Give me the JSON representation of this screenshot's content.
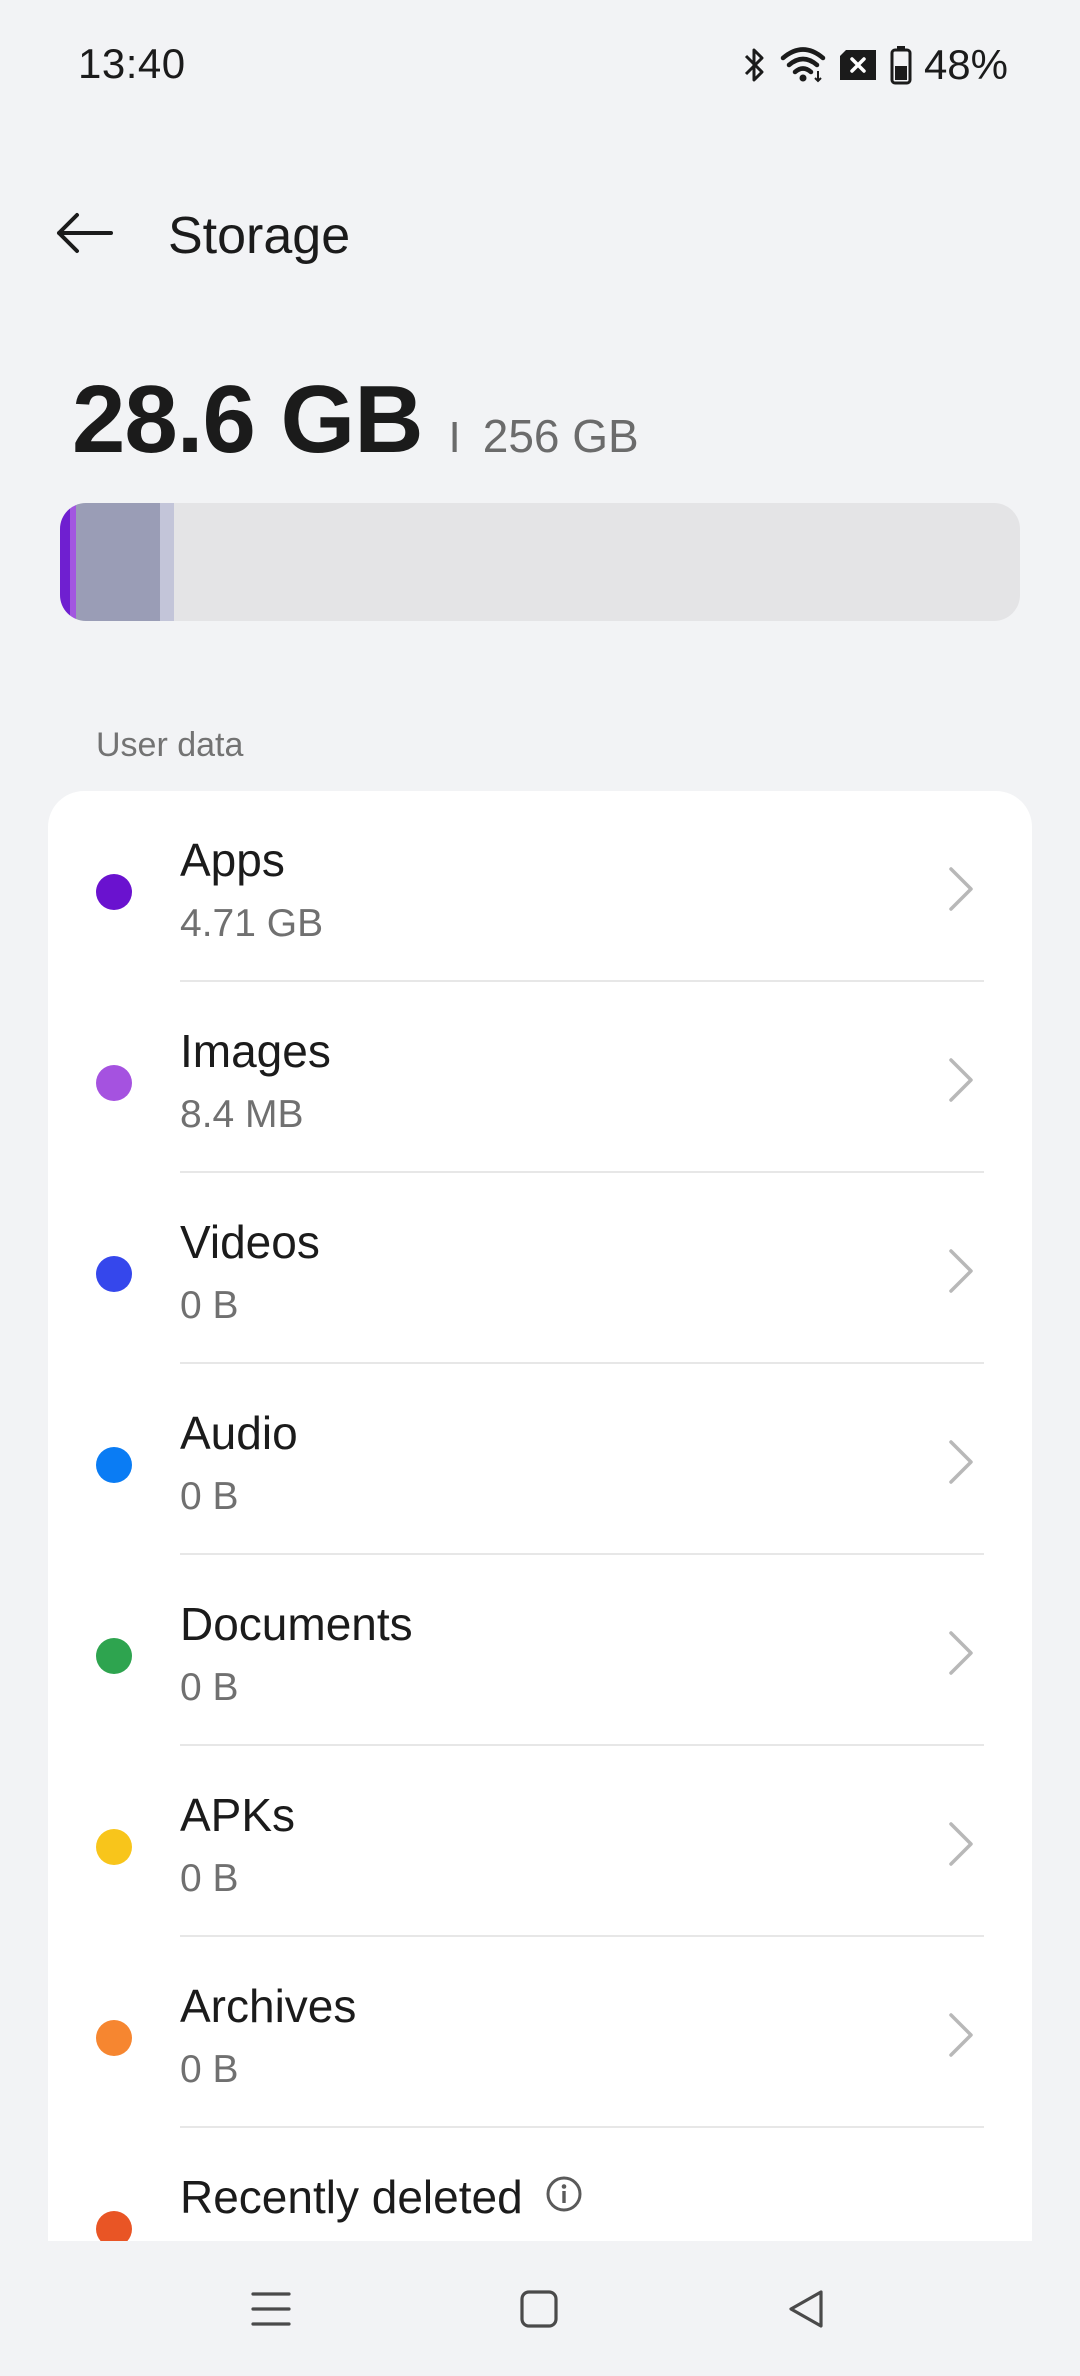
{
  "status_bar": {
    "time": "13:40",
    "battery": "48%",
    "icons": [
      "bluetooth-icon",
      "wifi-icon",
      "no-sim-icon",
      "battery-icon"
    ]
  },
  "header": {
    "title": "Storage",
    "back_icon": "arrow-left-icon"
  },
  "summary": {
    "used": "28.6 GB",
    "separator": "I",
    "total": "256 GB"
  },
  "storage_bar": {
    "segments": [
      {
        "category": "Apps",
        "color": "#6f1fd0"
      },
      {
        "category": "Images",
        "color": "#a257e0"
      },
      {
        "category": "Other",
        "color": "#9a9db6"
      },
      {
        "category": "System",
        "color": "#c3c5d9"
      }
    ],
    "background": "#e4e4e6"
  },
  "section": {
    "label": "User data"
  },
  "items": [
    {
      "title": "Apps",
      "size": "4.71 GB",
      "color": "#6a12cf"
    },
    {
      "title": "Images",
      "size": "8.4 MB",
      "color": "#a552e0"
    },
    {
      "title": "Videos",
      "size": "0 B",
      "color": "#3547ec"
    },
    {
      "title": "Audio",
      "size": "0 B",
      "color": "#0a7cf4"
    },
    {
      "title": "Documents",
      "size": "0 B",
      "color": "#2ea44f"
    },
    {
      "title": "APKs",
      "size": "0 B",
      "color": "#f8c51b"
    },
    {
      "title": "Archives",
      "size": "0 B",
      "color": "#f68630"
    },
    {
      "title": "Recently deleted",
      "size": "",
      "color": "#e95525",
      "info_icon": "info-icon"
    }
  ],
  "nav_bar": {
    "buttons": [
      "menu-icon",
      "home-square-icon",
      "back-triangle-icon"
    ]
  }
}
